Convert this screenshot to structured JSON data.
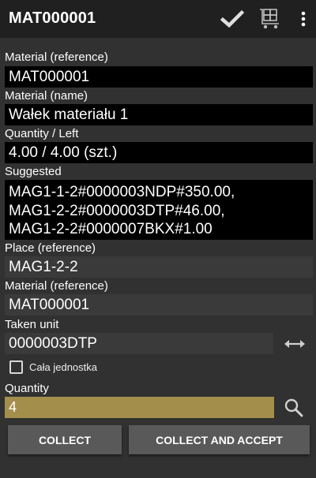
{
  "appbar": {
    "title": "MAT000001",
    "actions": [
      "check-icon",
      "cart-icon",
      "more-vert-icon"
    ]
  },
  "form": {
    "material_ref_label": "Material (reference)",
    "material_ref_value": "MAT000001",
    "material_name_label": "Material (name)",
    "material_name_value": "Wałek materiału 1",
    "quantity_left_label": "Quantity / Left",
    "quantity_left_value": "4.00 / 4.00 (szt.)",
    "suggested_label": "Suggested",
    "suggested_lines": [
      "MAG1-1-2#0000003NDP#350.00,",
      "MAG1-2-2#0000003DTP#46.00,",
      "MAG1-2-2#0000007BKX#1.00"
    ],
    "place_ref_label": "Place (reference)",
    "place_ref_value": "MAG1-2-2",
    "material_ref2_label": "Material (reference)",
    "material_ref2_value": "MAT000001",
    "taken_unit_label": "Taken unit",
    "taken_unit_value": "0000003DTP",
    "whole_unit_label": "Cała jednostka",
    "whole_unit_checked": false,
    "quantity_label": "Quantity",
    "quantity_value": "4"
  },
  "buttons": {
    "collect": "COLLECT",
    "collect_accept": "COLLECT AND ACCEPT"
  },
  "colors": {
    "background": "#313131",
    "appbar": "#202020",
    "readonly_box": "#000000",
    "input_box": "#3a3a3a",
    "quantity_highlight": "#a48e4c",
    "button": "#595959"
  }
}
